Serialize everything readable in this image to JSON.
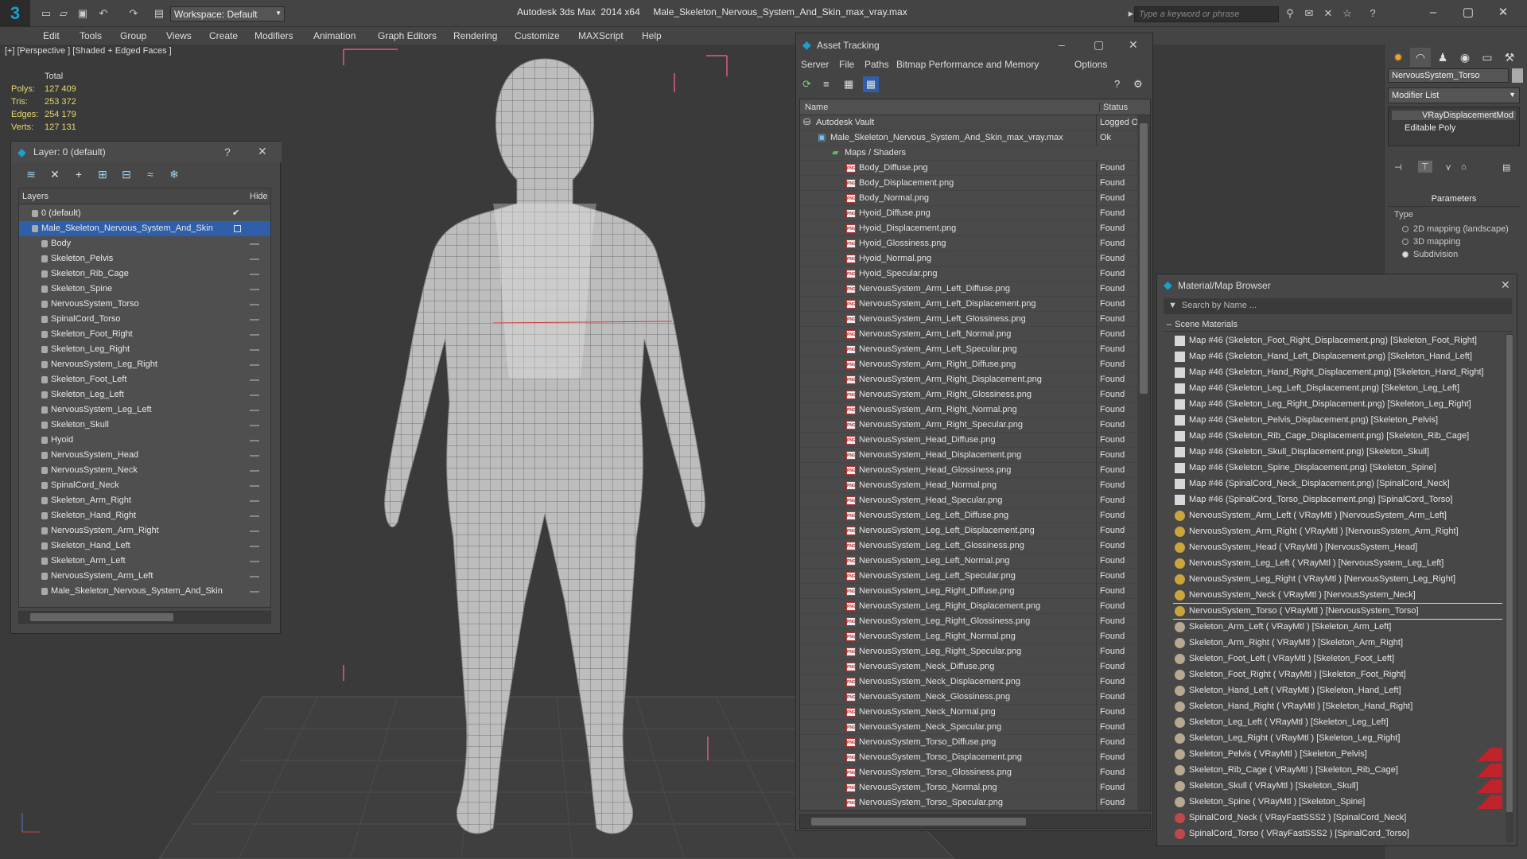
{
  "app": {
    "logo": "3",
    "workspace": "Workspace: Default",
    "title": "Autodesk 3ds Max  2014 x64     Male_Skeleton_Nervous_System_And_Skin_max_vray.max",
    "search_placeholder": "Type a keyword or phrase"
  },
  "menu": [
    "Edit",
    "Tools",
    "Group",
    "Views",
    "Create",
    "Modifiers",
    "Animation",
    "Graph Editors",
    "Rendering",
    "Customize",
    "MAXScript",
    "Help"
  ],
  "viewport": {
    "label": "[+] [Perspective ] [Shaded + Edged Faces ]",
    "stats": {
      "total_label": "Total",
      "polys_label": "Polys:",
      "polys": "127 409",
      "tris_label": "Tris:",
      "tris": "253 372",
      "edges_label": "Edges:",
      "edges": "254 179",
      "verts_label": "Verts:",
      "verts": "127 131"
    }
  },
  "layer_panel": {
    "title": "Layer: 0 (default)",
    "help": "?",
    "col_layers": "Layers",
    "col_hide": "Hide",
    "rows": [
      {
        "label": "0 (default)",
        "indent": 0
      },
      {
        "label": "Male_Skeleton_Nervous_System_And_Skin",
        "indent": 0,
        "selected": true
      },
      {
        "label": "Body",
        "indent": 1
      },
      {
        "label": "Skeleton_Pelvis",
        "indent": 1
      },
      {
        "label": "Skeleton_Rib_Cage",
        "indent": 1
      },
      {
        "label": "Skeleton_Spine",
        "indent": 1
      },
      {
        "label": "NervousSystem_Torso",
        "indent": 1
      },
      {
        "label": "SpinalCord_Torso",
        "indent": 1
      },
      {
        "label": "Skeleton_Foot_Right",
        "indent": 1
      },
      {
        "label": "Skeleton_Leg_Right",
        "indent": 1
      },
      {
        "label": "NervousSystem_Leg_Right",
        "indent": 1
      },
      {
        "label": "Skeleton_Foot_Left",
        "indent": 1
      },
      {
        "label": "Skeleton_Leg_Left",
        "indent": 1
      },
      {
        "label": "NervousSystem_Leg_Left",
        "indent": 1
      },
      {
        "label": "Skeleton_Skull",
        "indent": 1
      },
      {
        "label": "Hyoid",
        "indent": 1
      },
      {
        "label": "NervousSystem_Head",
        "indent": 1
      },
      {
        "label": "NervousSystem_Neck",
        "indent": 1
      },
      {
        "label": "SpinalCord_Neck",
        "indent": 1
      },
      {
        "label": "Skeleton_Arm_Right",
        "indent": 1
      },
      {
        "label": "Skeleton_Hand_Right",
        "indent": 1
      },
      {
        "label": "NervousSystem_Arm_Right",
        "indent": 1
      },
      {
        "label": "Skeleton_Hand_Left",
        "indent": 1
      },
      {
        "label": "Skeleton_Arm_Left",
        "indent": 1
      },
      {
        "label": "NervousSystem_Arm_Left",
        "indent": 1
      },
      {
        "label": "Male_Skeleton_Nervous_System_And_Skin",
        "indent": 1
      }
    ]
  },
  "asset_panel": {
    "title": "Asset Tracking",
    "menu": [
      "Server",
      "File",
      "Paths",
      "Bitmap Performance and Memory",
      "Options"
    ],
    "col_name": "Name",
    "col_status": "Status",
    "rows": [
      {
        "name": "Autodesk Vault",
        "status": "Logged O",
        "indent": 0,
        "kind": "vault"
      },
      {
        "name": "Male_Skeleton_Nervous_System_And_Skin_max_vray.max",
        "status": "Ok",
        "indent": 1,
        "kind": "max"
      },
      {
        "name": "Maps / Shaders",
        "status": "",
        "indent": 2,
        "kind": "folder"
      },
      {
        "name": "Body_Diffuse.png",
        "status": "Found"
      },
      {
        "name": "Body_Displacement.png",
        "status": "Found"
      },
      {
        "name": "Body_Normal.png",
        "status": "Found"
      },
      {
        "name": "Hyoid_Diffuse.png",
        "status": "Found"
      },
      {
        "name": "Hyoid_Displacement.png",
        "status": "Found"
      },
      {
        "name": "Hyoid_Glossiness.png",
        "status": "Found"
      },
      {
        "name": "Hyoid_Normal.png",
        "status": "Found"
      },
      {
        "name": "Hyoid_Specular.png",
        "status": "Found"
      },
      {
        "name": "NervousSystem_Arm_Left_Diffuse.png",
        "status": "Found"
      },
      {
        "name": "NervousSystem_Arm_Left_Displacement.png",
        "status": "Found"
      },
      {
        "name": "NervousSystem_Arm_Left_Glossiness.png",
        "status": "Found"
      },
      {
        "name": "NervousSystem_Arm_Left_Normal.png",
        "status": "Found"
      },
      {
        "name": "NervousSystem_Arm_Left_Specular.png",
        "status": "Found"
      },
      {
        "name": "NervousSystem_Arm_Right_Diffuse.png",
        "status": "Found"
      },
      {
        "name": "NervousSystem_Arm_Right_Displacement.png",
        "status": "Found"
      },
      {
        "name": "NervousSystem_Arm_Right_Glossiness.png",
        "status": "Found"
      },
      {
        "name": "NervousSystem_Arm_Right_Normal.png",
        "status": "Found"
      },
      {
        "name": "NervousSystem_Arm_Right_Specular.png",
        "status": "Found"
      },
      {
        "name": "NervousSystem_Head_Diffuse.png",
        "status": "Found"
      },
      {
        "name": "NervousSystem_Head_Displacement.png",
        "status": "Found"
      },
      {
        "name": "NervousSystem_Head_Glossiness.png",
        "status": "Found"
      },
      {
        "name": "NervousSystem_Head_Normal.png",
        "status": "Found"
      },
      {
        "name": "NervousSystem_Head_Specular.png",
        "status": "Found"
      },
      {
        "name": "NervousSystem_Leg_Left_Diffuse.png",
        "status": "Found"
      },
      {
        "name": "NervousSystem_Leg_Left_Displacement.png",
        "status": "Found"
      },
      {
        "name": "NervousSystem_Leg_Left_Glossiness.png",
        "status": "Found"
      },
      {
        "name": "NervousSystem_Leg_Left_Normal.png",
        "status": "Found"
      },
      {
        "name": "NervousSystem_Leg_Left_Specular.png",
        "status": "Found"
      },
      {
        "name": "NervousSystem_Leg_Right_Diffuse.png",
        "status": "Found"
      },
      {
        "name": "NervousSystem_Leg_Right_Displacement.png",
        "status": "Found"
      },
      {
        "name": "NervousSystem_Leg_Right_Glossiness.png",
        "status": "Found"
      },
      {
        "name": "NervousSystem_Leg_Right_Normal.png",
        "status": "Found"
      },
      {
        "name": "NervousSystem_Leg_Right_Specular.png",
        "status": "Found"
      },
      {
        "name": "NervousSystem_Neck_Diffuse.png",
        "status": "Found"
      },
      {
        "name": "NervousSystem_Neck_Displacement.png",
        "status": "Found"
      },
      {
        "name": "NervousSystem_Neck_Glossiness.png",
        "status": "Found"
      },
      {
        "name": "NervousSystem_Neck_Normal.png",
        "status": "Found"
      },
      {
        "name": "NervousSystem_Neck_Specular.png",
        "status": "Found"
      },
      {
        "name": "NervousSystem_Torso_Diffuse.png",
        "status": "Found"
      },
      {
        "name": "NervousSystem_Torso_Displacement.png",
        "status": "Found"
      },
      {
        "name": "NervousSystem_Torso_Glossiness.png",
        "status": "Found"
      },
      {
        "name": "NervousSystem_Torso_Normal.png",
        "status": "Found"
      },
      {
        "name": "NervousSystem_Torso_Specular.png",
        "status": "Found"
      }
    ]
  },
  "command_panel": {
    "object_name": "NervousSystem_Torso",
    "modifier_list": "Modifier List",
    "stack": [
      "VRayDisplacementMod",
      "Editable Poly"
    ],
    "params_title": "Parameters",
    "type_label": "Type",
    "radios": [
      {
        "label": "2D mapping (landscape)",
        "on": false
      },
      {
        "label": "3D mapping",
        "on": false
      },
      {
        "label": "Subdivision",
        "on": true
      }
    ]
  },
  "material_browser": {
    "title": "Material/Map Browser",
    "search_placeholder": "Search by Name ...",
    "section": "Scene Materials",
    "rows": [
      {
        "text": "Map #46 (Skeleton_Foot_Right_Displacement.png) [Skeleton_Foot_Right]",
        "kind": "map"
      },
      {
        "text": "Map #46 (Skeleton_Hand_Left_Displacement.png) [Skeleton_Hand_Left]",
        "kind": "map"
      },
      {
        "text": "Map #46 (Skeleton_Hand_Right_Displacement.png) [Skeleton_Hand_Right]",
        "kind": "map"
      },
      {
        "text": "Map #46 (Skeleton_Leg_Left_Displacement.png) [Skeleton_Leg_Left]",
        "kind": "map"
      },
      {
        "text": "Map #46 (Skeleton_Leg_Right_Displacement.png) [Skeleton_Leg_Right]",
        "kind": "map"
      },
      {
        "text": "Map #46 (Skeleton_Pelvis_Displacement.png) [Skeleton_Pelvis]",
        "kind": "map"
      },
      {
        "text": "Map #46 (Skeleton_Rib_Cage_Displacement.png) [Skeleton_Rib_Cage]",
        "kind": "map"
      },
      {
        "text": "Map #46 (Skeleton_Skull_Displacement.png) [Skeleton_Skull]",
        "kind": "map"
      },
      {
        "text": "Map #46 (Skeleton_Spine_Displacement.png) [Skeleton_Spine]",
        "kind": "map"
      },
      {
        "text": "Map #46 (SpinalCord_Neck_Displacement.png) [SpinalCord_Neck]",
        "kind": "map"
      },
      {
        "text": "Map #46 (SpinalCord_Torso_Displacement.png) [SpinalCord_Torso]",
        "kind": "map"
      },
      {
        "text": "NervousSystem_Arm_Left  ( VRayMtl ) [NervousSystem_Arm_Left]",
        "kind": "nerve"
      },
      {
        "text": "NervousSystem_Arm_Right  ( VRayMtl ) [NervousSystem_Arm_Right]",
        "kind": "nerve"
      },
      {
        "text": "NervousSystem_Head  ( VRayMtl ) [NervousSystem_Head]",
        "kind": "nerve"
      },
      {
        "text": "NervousSystem_Leg_Left  ( VRayMtl ) [NervousSystem_Leg_Left]",
        "kind": "nerve"
      },
      {
        "text": "NervousSystem_Leg_Right  ( VRayMtl ) [NervousSystem_Leg_Right]",
        "kind": "nerve"
      },
      {
        "text": "NervousSystem_Neck  ( VRayMtl ) [NervousSystem_Neck]",
        "kind": "nerve"
      },
      {
        "text": "NervousSystem_Torso  ( VRayMtl ) [NervousSystem_Torso]",
        "kind": "nerve",
        "highlight": true
      },
      {
        "text": "Skeleton_Arm_Left  ( VRayMtl ) [Skeleton_Arm_Left]",
        "kind": "bone"
      },
      {
        "text": "Skeleton_Arm_Right  ( VRayMtl ) [Skeleton_Arm_Right]",
        "kind": "bone"
      },
      {
        "text": "Skeleton_Foot_Left  ( VRayMtl ) [Skeleton_Foot_Left]",
        "kind": "bone"
      },
      {
        "text": "Skeleton_Foot_Right  ( VRayMtl ) [Skeleton_Foot_Right]",
        "kind": "bone"
      },
      {
        "text": "Skeleton_Hand_Left  ( VRayMtl ) [Skeleton_Hand_Left]",
        "kind": "bone"
      },
      {
        "text": "Skeleton_Hand_Right  ( VRayMtl ) [Skeleton_Hand_Right]",
        "kind": "bone"
      },
      {
        "text": "Skeleton_Leg_Left  ( VRayMtl ) [Skeleton_Leg_Left]",
        "kind": "bone"
      },
      {
        "text": "Skeleton_Leg_Right  ( VRayMtl ) [Skeleton_Leg_Right]",
        "kind": "bone"
      },
      {
        "text": "Skeleton_Pelvis  ( VRayMtl ) [Skeleton_Pelvis]",
        "kind": "bone",
        "flag": true
      },
      {
        "text": "Skeleton_Rib_Cage  ( VRayMtl ) [Skeleton_Rib_Cage]",
        "kind": "bone",
        "flag": true
      },
      {
        "text": "Skeleton_Skull  ( VRayMtl ) [Skeleton_Skull]",
        "kind": "bone",
        "flag": true
      },
      {
        "text": "Skeleton_Spine  ( VRayMtl ) [Skeleton_Spine]",
        "kind": "bone",
        "flag": true
      },
      {
        "text": "SpinalCord_Neck  ( VRayFastSSS2 ) [SpinalCord_Neck]",
        "kind": "sss"
      },
      {
        "text": "SpinalCord_Torso  ( VRayFastSSS2 ) [SpinalCord_Torso]",
        "kind": "sss"
      }
    ]
  },
  "colors": {
    "selection": "#2f5fa8",
    "stats_text": "#e6d76a",
    "gizmo_box": "#e05a8a",
    "status_flag": "#c0232b"
  }
}
